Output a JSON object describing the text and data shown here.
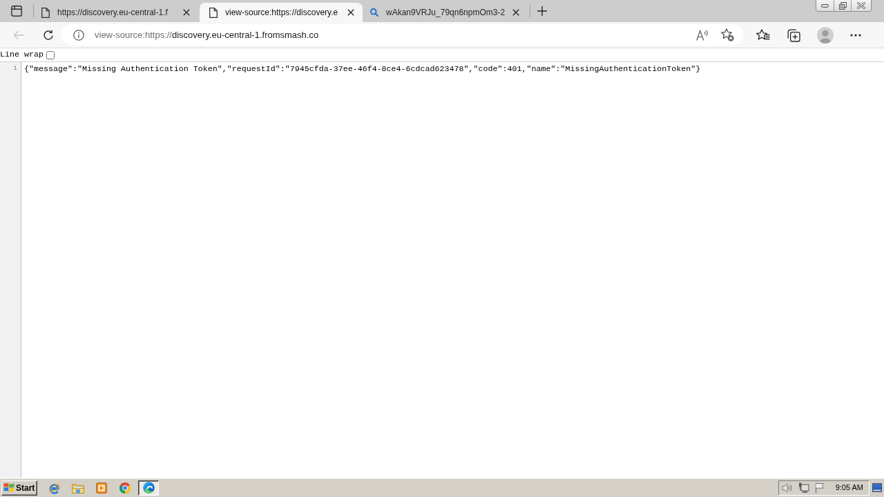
{
  "tabs": [
    {
      "title": "https://discovery.eu-central-1.f",
      "kind": "page",
      "selected": false
    },
    {
      "title": "view-source:https://discovery.e",
      "kind": "page",
      "selected": true
    },
    {
      "title": "wAkan9VRJu_79qn6npmOm3-2",
      "kind": "search",
      "selected": false
    }
  ],
  "back_button": {
    "disabled": true
  },
  "address": {
    "scheme": "view-source:https://",
    "host": "discovery.eu-central-1.fromsmash.co"
  },
  "line_wrap": {
    "label": "Line wrap",
    "checked": false
  },
  "source": {
    "lines": [
      {
        "number": "1",
        "text": "{\"message\":\"Missing Authentication Token\",\"requestId\":\"7945cfda-37ee-46f4-8ce4-6cdcad623478\",\"code\":401,\"name\":\"MissingAuthenticationToken\"}"
      }
    ]
  },
  "taskbar": {
    "start": "Start",
    "apps": [
      {
        "kind": "ie",
        "selected": false
      },
      {
        "kind": "folder",
        "selected": false
      },
      {
        "kind": "media",
        "selected": false
      },
      {
        "kind": "chrome",
        "selected": false
      },
      {
        "kind": "edge",
        "selected": true
      }
    ],
    "clock": "9:05 AM"
  }
}
